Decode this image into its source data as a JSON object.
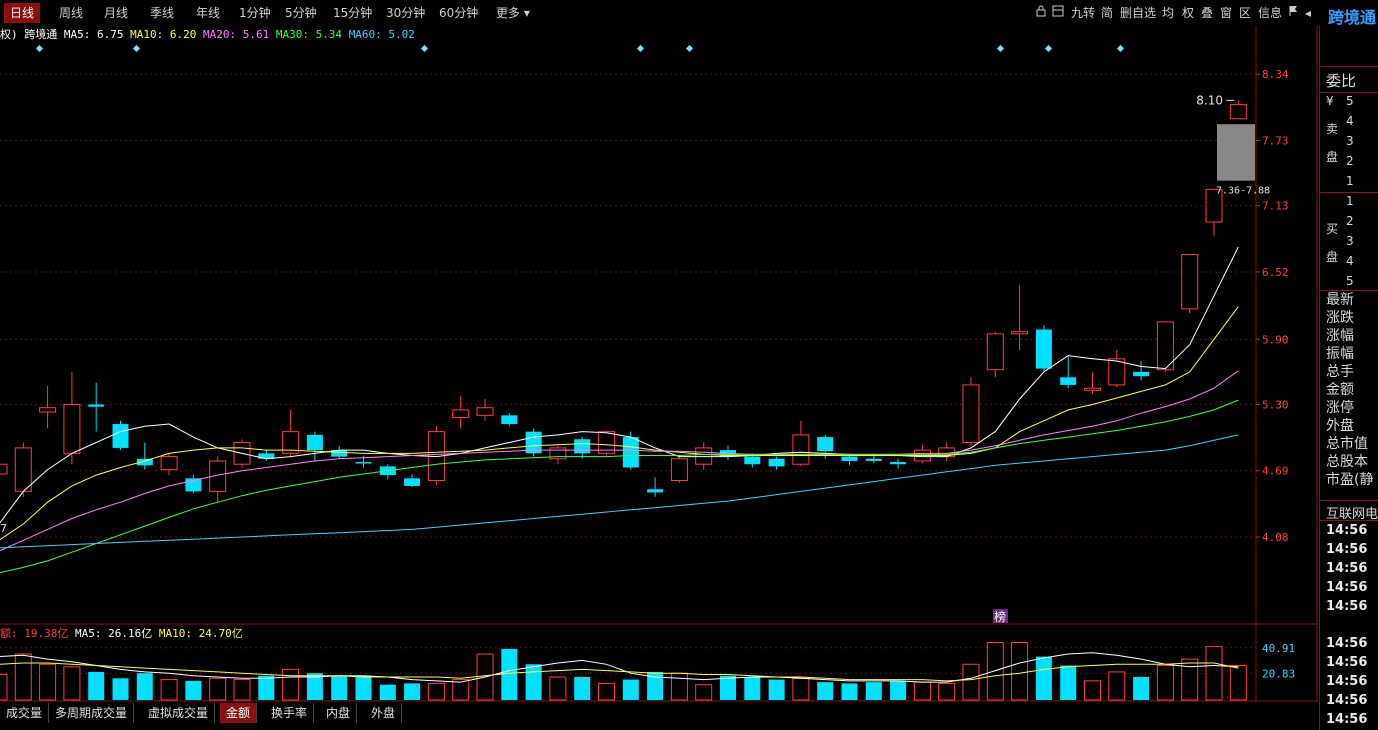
{
  "toolbar": {
    "period_tabs": [
      "日线",
      "周线",
      "月线",
      "季线",
      "年线",
      "1分钟",
      "5分钟",
      "15分钟",
      "30分钟",
      "60分钟",
      "更多"
    ],
    "active_tab": "日线",
    "right_tools": [
      "九转",
      "简",
      "删自选",
      "均",
      "权",
      "叠",
      "窗",
      "区",
      "信息"
    ],
    "stock_name": "跨境通"
  },
  "ma_legend": {
    "prefix": "权) 跨境通",
    "items": [
      {
        "label": "MA5: 6.75",
        "color": "#ffffff"
      },
      {
        "label": "MA10: 6.20",
        "color": "#ffff40"
      },
      {
        "label": "MA20: 5.61",
        "color": "#ff80ff"
      },
      {
        "label": "MA30: 5.34",
        "color": "#40ff40"
      },
      {
        "label": "MA60: 5.02",
        "color": "#40d0ff"
      }
    ]
  },
  "price_axis": [
    "8.34",
    "7.73",
    "7.13",
    "6.52",
    "5.90",
    "5.30",
    "4.69",
    "4.08"
  ],
  "vol_axis": [
    "40.91",
    "20.83"
  ],
  "annotations": {
    "high_label": "8.10",
    "range_label": "7.36-7.88",
    "bang_badge": "榜",
    "left_edge_number": "7"
  },
  "vol_legend": {
    "items": [
      {
        "label": "额: 19.38亿",
        "color": "#ff4040"
      },
      {
        "label": "MA5: 26.16亿",
        "color": "#ffffff"
      },
      {
        "label": "MA10: 24.70亿",
        "color": "#ffff40"
      }
    ]
  },
  "bottom_tabs": [
    "成交量",
    "多周期成交量",
    "虚拟成交量",
    "金额",
    "换手率",
    "内盘",
    "外盘"
  ],
  "active_bottom_tab": "金额",
  "side_panel": {
    "weibi": "委比",
    "yen": "¥",
    "sell_label_1": "卖",
    "sell_label_2": "盘",
    "sell_levels": [
      "5",
      "4",
      "3",
      "2",
      "1"
    ],
    "buy_label_1": "买",
    "buy_label_2": "盘",
    "buy_levels": [
      "1",
      "2",
      "3",
      "4",
      "5"
    ],
    "stats": [
      "最新",
      "涨跌",
      "涨幅",
      "振幅",
      "总手",
      "金额",
      "涨停",
      "外盘",
      "总市值",
      "总股本",
      "市盈(静"
    ],
    "sector": "互联网电商",
    "times": [
      "14:56",
      "14:56",
      "14:56",
      "14:56",
      "14:56",
      "14:56",
      "14:56",
      "14:56",
      "14:56",
      "14:56"
    ]
  },
  "chart_data": {
    "type": "candlestick",
    "price_range": [
      3.5,
      8.6
    ],
    "candles": [
      {
        "o": 4.66,
        "c": 4.75,
        "h": 4.8,
        "l": 4.55
      },
      {
        "o": 4.5,
        "c": 4.9,
        "h": 4.95,
        "l": 4.45
      },
      {
        "o": 5.23,
        "c": 5.27,
        "h": 5.47,
        "l": 5.08
      },
      {
        "o": 4.85,
        "c": 5.3,
        "h": 5.6,
        "l": 4.75
      },
      {
        "o": 5.3,
        "c": 5.28,
        "h": 5.5,
        "l": 5.05
      },
      {
        "o": 5.12,
        "c": 4.9,
        "h": 5.15,
        "l": 4.88
      },
      {
        "o": 4.8,
        "c": 4.74,
        "h": 4.95,
        "l": 4.7
      },
      {
        "o": 4.7,
        "c": 4.82,
        "h": 4.85,
        "l": 4.65
      },
      {
        "o": 4.62,
        "c": 4.5,
        "h": 4.65,
        "l": 4.48
      },
      {
        "o": 4.5,
        "c": 4.78,
        "h": 4.82,
        "l": 4.4
      },
      {
        "o": 4.75,
        "c": 4.95,
        "h": 4.98,
        "l": 4.72
      },
      {
        "o": 4.85,
        "c": 4.8,
        "h": 4.88,
        "l": 4.78
      },
      {
        "o": 4.85,
        "c": 5.05,
        "h": 5.25,
        "l": 4.82
      },
      {
        "o": 5.02,
        "c": 4.88,
        "h": 5.05,
        "l": 4.78
      },
      {
        "o": 4.88,
        "c": 4.82,
        "h": 4.92,
        "l": 4.8
      },
      {
        "o": 4.77,
        "c": 4.76,
        "h": 4.83,
        "l": 4.72
      },
      {
        "o": 4.73,
        "c": 4.65,
        "h": 4.75,
        "l": 4.61
      },
      {
        "o": 4.62,
        "c": 4.55,
        "h": 4.66,
        "l": 4.54
      },
      {
        "o": 4.6,
        "c": 5.05,
        "h": 5.1,
        "l": 4.56
      },
      {
        "o": 5.18,
        "c": 5.25,
        "h": 5.38,
        "l": 5.08
      },
      {
        "o": 5.2,
        "c": 5.27,
        "h": 5.35,
        "l": 5.15
      },
      {
        "o": 5.2,
        "c": 5.12,
        "h": 5.22,
        "l": 5.1
      },
      {
        "o": 5.05,
        "c": 4.85,
        "h": 5.08,
        "l": 4.82
      },
      {
        "o": 4.8,
        "c": 4.9,
        "h": 4.92,
        "l": 4.75
      },
      {
        "o": 4.98,
        "c": 4.85,
        "h": 5.0,
        "l": 4.8
      },
      {
        "o": 4.85,
        "c": 5.05,
        "h": 5.05,
        "l": 4.83
      },
      {
        "o": 5.0,
        "c": 4.72,
        "h": 5.05,
        "l": 4.7
      },
      {
        "o": 4.52,
        "c": 4.49,
        "h": 4.63,
        "l": 4.45
      },
      {
        "o": 4.6,
        "c": 4.8,
        "h": 4.82,
        "l": 4.58
      },
      {
        "o": 4.75,
        "c": 4.9,
        "h": 4.95,
        "l": 4.7
      },
      {
        "o": 4.88,
        "c": 4.82,
        "h": 4.92,
        "l": 4.79
      },
      {
        "o": 4.82,
        "c": 4.75,
        "h": 4.85,
        "l": 4.72
      },
      {
        "o": 4.8,
        "c": 4.73,
        "h": 4.82,
        "l": 4.7
      },
      {
        "o": 4.75,
        "c": 5.02,
        "h": 5.15,
        "l": 4.73
      },
      {
        "o": 5.0,
        "c": 4.87,
        "h": 5.02,
        "l": 4.8
      },
      {
        "o": 4.82,
        "c": 4.78,
        "h": 4.83,
        "l": 4.74
      },
      {
        "o": 4.8,
        "c": 4.78,
        "h": 4.85,
        "l": 4.76
      },
      {
        "o": 4.77,
        "c": 4.75,
        "h": 4.8,
        "l": 4.71
      },
      {
        "o": 4.78,
        "c": 4.88,
        "h": 4.93,
        "l": 4.76
      },
      {
        "o": 4.82,
        "c": 4.9,
        "h": 4.95,
        "l": 4.78
      },
      {
        "o": 4.95,
        "c": 5.48,
        "h": 5.55,
        "l": 4.92
      },
      {
        "o": 5.62,
        "c": 5.95,
        "h": 5.97,
        "l": 5.55
      },
      {
        "o": 5.95,
        "c": 5.97,
        "h": 6.4,
        "l": 5.8
      },
      {
        "o": 5.99,
        "c": 5.63,
        "h": 6.03,
        "l": 5.6
      },
      {
        "o": 5.55,
        "c": 5.48,
        "h": 5.75,
        "l": 5.45
      },
      {
        "o": 5.43,
        "c": 5.45,
        "h": 5.6,
        "l": 5.4
      },
      {
        "o": 5.48,
        "c": 5.72,
        "h": 5.8,
        "l": 5.46
      },
      {
        "o": 5.6,
        "c": 5.56,
        "h": 5.7,
        "l": 5.52
      },
      {
        "o": 5.62,
        "c": 6.06,
        "h": 6.06,
        "l": 5.6
      },
      {
        "o": 6.18,
        "c": 6.68,
        "h": 6.68,
        "l": 6.14
      },
      {
        "o": 6.98,
        "c": 7.28,
        "h": 7.28,
        "l": 6.85
      },
      {
        "o": 7.93,
        "c": 8.06,
        "h": 8.1,
        "l": 7.93
      }
    ],
    "ma_lines": [
      {
        "name": "MA5",
        "color": "#ffffff",
        "values": [
          4.2,
          4.5,
          4.7,
          4.85,
          4.95,
          5.05,
          5.1,
          5.12,
          5.0,
          4.9,
          4.85,
          4.8,
          4.82,
          4.85,
          4.88,
          4.88,
          4.85,
          4.83,
          4.82,
          4.85,
          4.9,
          4.95,
          5.0,
          5.02,
          5.05,
          5.04,
          5.0,
          4.9,
          4.82,
          4.82,
          4.82,
          4.83,
          4.85,
          4.86,
          4.85,
          4.84,
          4.83,
          4.83,
          4.82,
          4.82,
          4.9,
          5.05,
          5.35,
          5.6,
          5.75,
          5.72,
          5.7,
          5.65,
          5.63,
          5.85,
          6.3,
          6.75
        ]
      },
      {
        "name": "MA10",
        "color": "#ffff40",
        "values": [
          4.05,
          4.2,
          4.4,
          4.55,
          4.65,
          4.72,
          4.78,
          4.85,
          4.88,
          4.9,
          4.9,
          4.88,
          4.88,
          4.87,
          4.86,
          4.85,
          4.85,
          4.85,
          4.86,
          4.87,
          4.88,
          4.9,
          4.92,
          4.93,
          4.94,
          4.93,
          4.91,
          4.88,
          4.86,
          4.84,
          4.83,
          4.83,
          4.83,
          4.83,
          4.83,
          4.83,
          4.83,
          4.83,
          4.83,
          4.83,
          4.85,
          4.9,
          5.05,
          5.15,
          5.25,
          5.3,
          5.36,
          5.42,
          5.48,
          5.6,
          5.9,
          6.2
        ]
      },
      {
        "name": "MA20",
        "color": "#ff80ff",
        "values": [
          3.95,
          4.05,
          4.15,
          4.25,
          4.33,
          4.4,
          4.48,
          4.55,
          4.6,
          4.65,
          4.69,
          4.72,
          4.75,
          4.78,
          4.8,
          4.81,
          4.82,
          4.83,
          4.84,
          4.85,
          4.86,
          4.87,
          4.88,
          4.88,
          4.88,
          4.88,
          4.88,
          4.87,
          4.87,
          4.86,
          4.85,
          4.84,
          4.84,
          4.84,
          4.84,
          4.84,
          4.84,
          4.84,
          4.85,
          4.85,
          4.88,
          4.92,
          4.97,
          5.02,
          5.06,
          5.1,
          5.15,
          5.22,
          5.28,
          5.35,
          5.45,
          5.61
        ]
      },
      {
        "name": "MA30",
        "color": "#40ff40",
        "values": [
          3.75,
          3.8,
          3.86,
          3.94,
          4.02,
          4.1,
          4.18,
          4.26,
          4.34,
          4.4,
          4.46,
          4.51,
          4.55,
          4.59,
          4.63,
          4.66,
          4.69,
          4.72,
          4.75,
          4.77,
          4.79,
          4.8,
          4.81,
          4.82,
          4.82,
          4.82,
          4.83,
          4.83,
          4.83,
          4.84,
          4.84,
          4.84,
          4.84,
          4.84,
          4.84,
          4.84,
          4.84,
          4.84,
          4.84,
          4.84,
          4.86,
          4.9,
          4.94,
          4.97,
          5.0,
          5.03,
          5.06,
          5.1,
          5.14,
          5.19,
          5.25,
          5.34
        ]
      },
      {
        "name": "MA60",
        "color": "#40d0ff",
        "values": [
          3.98,
          3.99,
          4.0,
          4.01,
          4.02,
          4.03,
          4.04,
          4.05,
          4.06,
          4.07,
          4.08,
          4.09,
          4.1,
          4.11,
          4.12,
          4.13,
          4.14,
          4.15,
          4.17,
          4.19,
          4.21,
          4.23,
          4.25,
          4.27,
          4.29,
          4.31,
          4.33,
          4.35,
          4.37,
          4.39,
          4.41,
          4.44,
          4.47,
          4.5,
          4.53,
          4.56,
          4.59,
          4.62,
          4.65,
          4.68,
          4.71,
          4.74,
          4.76,
          4.78,
          4.8,
          4.82,
          4.84,
          4.86,
          4.88,
          4.92,
          4.97,
          5.02
        ]
      }
    ],
    "amount_range": [
      0,
      47
    ],
    "amounts": [
      20,
      36,
      28,
      26,
      22,
      17,
      21,
      16,
      15,
      17,
      16,
      19,
      24,
      21,
      19,
      19,
      12,
      13,
      13,
      16,
      36,
      40,
      28,
      18,
      18,
      13,
      16,
      22,
      21,
      12,
      19,
      18,
      16,
      17,
      14,
      13,
      14,
      15,
      14,
      13,
      28,
      45,
      45,
      34,
      27,
      15,
      22,
      18,
      27,
      32,
      42,
      27
    ],
    "amount_ma": [
      {
        "name": "MA5",
        "color": "#ffffff",
        "values": [
          34,
          35,
          32,
          30,
          27,
          24,
          22,
          21,
          19,
          18,
          17,
          17,
          18,
          18,
          19,
          19,
          18,
          16,
          15,
          14,
          18,
          23,
          26,
          29,
          31,
          28,
          21,
          18,
          17,
          16,
          17,
          18,
          18,
          17,
          16,
          15,
          15,
          15,
          14,
          14,
          17,
          23,
          29,
          33,
          36,
          37,
          35,
          32,
          28,
          26,
          27,
          26
        ]
      },
      {
        "name": "MA10",
        "color": "#ffff40",
        "values": [
          28,
          29,
          29,
          28,
          27,
          26,
          25,
          24,
          23,
          22,
          21,
          20,
          19,
          19,
          19,
          18,
          18,
          18,
          18,
          17,
          19,
          21,
          22,
          23,
          24,
          23,
          22,
          21,
          21,
          20,
          20,
          19,
          18,
          18,
          17,
          16,
          16,
          16,
          16,
          15,
          16,
          19,
          21,
          24,
          26,
          27,
          28,
          28,
          28,
          29,
          29,
          25
        ]
      }
    ]
  }
}
